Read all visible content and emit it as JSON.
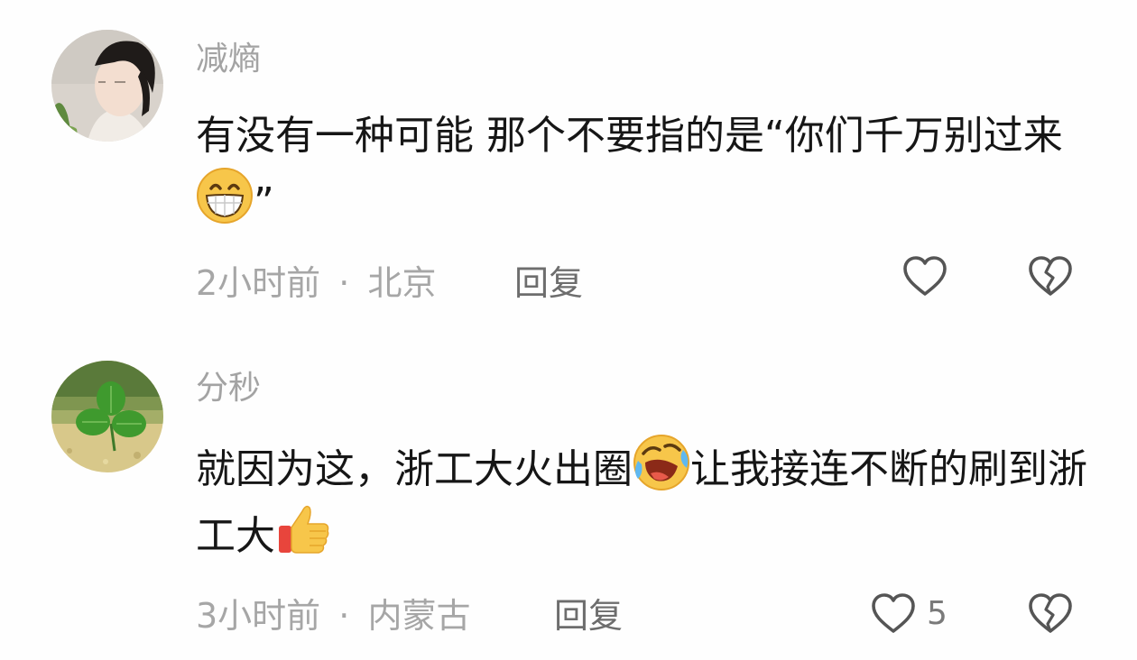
{
  "comments": [
    {
      "username": "减熵",
      "avatar_icon": "portrait-avatar",
      "text_before_emoji": "有没有一种可能 那个不要指的是“你们千万别过来",
      "emoji": "grinning-face-icon",
      "text_after_emoji": "”",
      "time": "2小时前",
      "separator": "·",
      "location": "北京",
      "reply_label": "回复",
      "like_count": "",
      "like_icon": "heart-outline-icon",
      "dislike_icon": "broken-heart-icon"
    },
    {
      "username": "分秒",
      "avatar_icon": "clover-avatar",
      "text_before_emoji": "就因为这，浙工大火出圈",
      "emoji": "rofl-face-icon",
      "text_after_emoji": "让我接连不断的刷到浙工大",
      "emoji2": "thumbs-up-icon",
      "time": "3小时前",
      "separator": "·",
      "location": "内蒙古",
      "reply_label": "回复",
      "like_count": "5",
      "like_icon": "heart-outline-icon",
      "dislike_icon": "broken-heart-icon"
    }
  ],
  "colors": {
    "username": "#a3a3a3",
    "text": "#161616",
    "meta": "#a6a6a6",
    "reply": "#6d6d6d",
    "icon": "#555555"
  }
}
